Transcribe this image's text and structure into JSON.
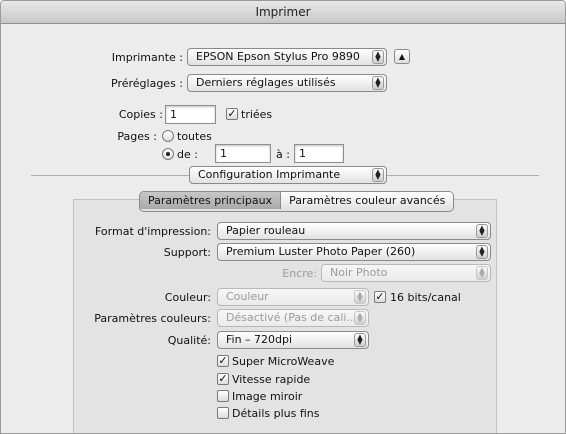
{
  "window": {
    "title": "Imprimer"
  },
  "printer": {
    "label": "Imprimante :",
    "value": "EPSON Epson Stylus Pro 9890"
  },
  "presets": {
    "label": "Préréglages :",
    "value": "Derniers réglages utilisés"
  },
  "copies": {
    "label": "Copies :",
    "value": "1",
    "collate_label": "triées",
    "collate_checked": true
  },
  "pages": {
    "label": "Pages :",
    "all_label": "toutes",
    "from_label": "de :",
    "from_value": "1",
    "to_label": "à :",
    "to_value": "1"
  },
  "section_popup": {
    "value": "Configuration Imprimante"
  },
  "tabs": [
    {
      "label": "Paramètres principaux",
      "selected": true
    },
    {
      "label": "Paramètres couleur avancés",
      "selected": false
    }
  ],
  "settings": {
    "format": {
      "label": "Format d'impression:",
      "value": "Papier rouleau"
    },
    "support": {
      "label": "Support:",
      "value": "Premium Luster Photo Paper (260)"
    },
    "encre": {
      "label": "Encre:",
      "value": "Noir Photo"
    },
    "couleur": {
      "label": "Couleur:",
      "value": "Couleur",
      "bits_label": "16 bits/canal",
      "bits_checked": true
    },
    "param_couleurs": {
      "label": "Paramètres couleurs:",
      "value": "Désactivé (Pas de cali..."
    },
    "qualite": {
      "label": "Qualité:",
      "value": "Fin – 720dpi"
    }
  },
  "options": [
    {
      "label": "Super MicroWeave",
      "checked": true
    },
    {
      "label": "Vitesse rapide",
      "checked": true
    },
    {
      "label": "Image miroir",
      "checked": false
    },
    {
      "label": "Détails plus fins",
      "checked": false
    }
  ],
  "icons": {
    "check": "✓",
    "popup_arrows": "▲▼",
    "disclosure": "▲"
  }
}
